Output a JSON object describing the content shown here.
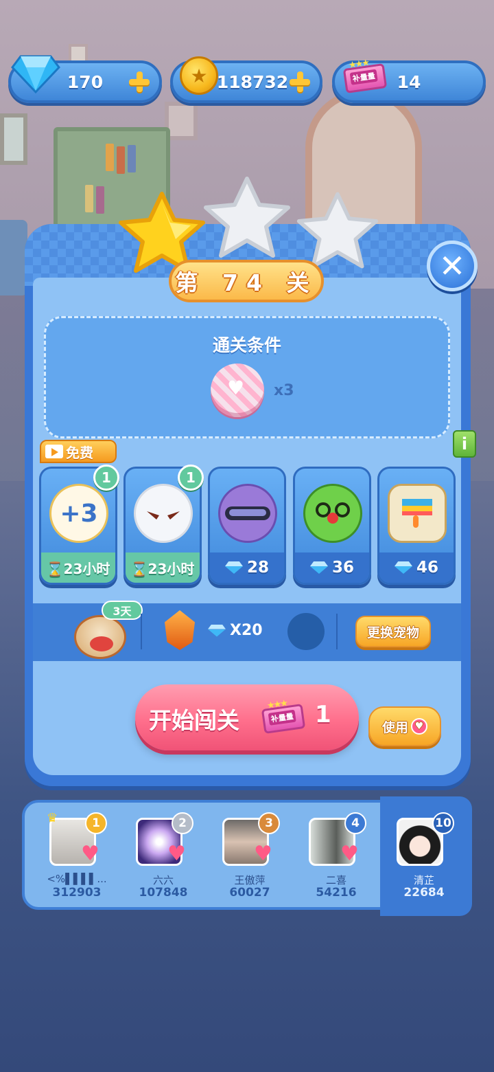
{
  "resources": {
    "diamonds": "170",
    "coins": "118732",
    "tickets": "14",
    "ticket_label": "补量量"
  },
  "stars": {
    "earned": 1,
    "total": 3
  },
  "level": {
    "title": "第 74 关"
  },
  "conditions": {
    "title": "通关条件",
    "item": "donut-heart-icon",
    "count": "x3"
  },
  "free_tag": "免费",
  "boosters": [
    {
      "icon": "glove-plus3-icon",
      "glyph": "+3",
      "badge": "1",
      "footer": "⌛23小时",
      "type": "free"
    },
    {
      "icon": "white-bunny-icon",
      "glyph": "",
      "badge": "1",
      "footer": "⌛23小时",
      "type": "free"
    },
    {
      "icon": "purple-cat-goggles-icon",
      "glyph": "",
      "badge": "",
      "footer": "28",
      "type": "paid"
    },
    {
      "icon": "green-frog-mustache-icon",
      "glyph": "",
      "badge": "",
      "footer": "36",
      "type": "paid"
    },
    {
      "icon": "paint-bucket-icon",
      "glyph": "",
      "badge": "",
      "footer": "46",
      "type": "paid"
    }
  ],
  "pet": {
    "days": "3天",
    "cost": "X20",
    "change_label": "更换宠物"
  },
  "start": {
    "label": "开始闯关",
    "count": "1",
    "use_label": "使用"
  },
  "leaderboard": [
    {
      "rank": "1",
      "name": "<%▌▌▌▌...",
      "score": "312903",
      "rank_color": "#f5b52a"
    },
    {
      "rank": "2",
      "name": "六六",
      "score": "107848",
      "rank_color": "#b4bcc8"
    },
    {
      "rank": "3",
      "name": "王傲萍",
      "score": "60027",
      "rank_color": "#d98a3a"
    },
    {
      "rank": "4",
      "name": "二喜",
      "score": "54216",
      "rank_color": "#3c7ad4"
    },
    {
      "rank": "10",
      "name": "清芷",
      "score": "22684",
      "rank_color": "#2a62b8"
    }
  ],
  "colors": {
    "panel": "#3a78d6",
    "start_button": "#ff6f8c",
    "yellow_button": "#f7a626",
    "free_green": "#62c99e"
  }
}
